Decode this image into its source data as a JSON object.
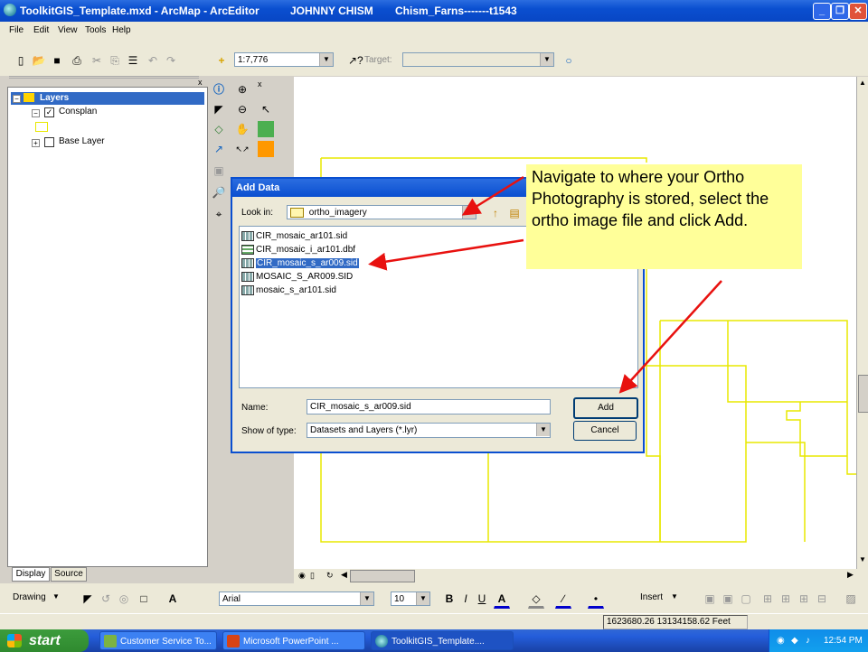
{
  "titlebar": {
    "doc": "ToolkitGIS_Template.mxd - ArcMap - ArcEditor",
    "user": "JOHNNY CHISM",
    "machine": "Chism_Farns-------t1543"
  },
  "menu": [
    "File",
    "Edit",
    "View",
    "Tools",
    "Help"
  ],
  "toolbar": {
    "scale": "1:7,776",
    "target_label": "Target:"
  },
  "toc": {
    "layers_label": "Layers",
    "consplan_label": "Consplan",
    "base_layer_label": "Base Layer",
    "tab_display": "Display",
    "tab_source": "Source"
  },
  "dialog": {
    "title": "Add Data",
    "look_in_label": "Look in:",
    "look_in_value": "ortho_imagery",
    "files": [
      {
        "name": "CIR_mosaic_ar101.sid",
        "type": "raster",
        "selected": false
      },
      {
        "name": "CIR_mosaic_i_ar101.dbf",
        "type": "table",
        "selected": false
      },
      {
        "name": "CIR_mosaic_s_ar009.sid",
        "type": "raster",
        "selected": true
      },
      {
        "name": "MOSAIC_S_AR009.SID",
        "type": "raster",
        "selected": false
      },
      {
        "name": "mosaic_s_ar101.sid",
        "type": "raster",
        "selected": false
      }
    ],
    "name_label": "Name:",
    "name_value": "CIR_mosaic_s_ar009.sid",
    "type_label": "Show of type:",
    "type_value": "Datasets and Layers (*.lyr)",
    "add_label": "Add",
    "cancel_label": "Cancel"
  },
  "callout": {
    "text": "Navigate to where your Ortho Photography is stored, select the ortho image file and click Add."
  },
  "drawing_toolbar": {
    "drawing_label": "Drawing",
    "font": "Arial",
    "size": "10",
    "insert_label": "Insert"
  },
  "status": {
    "coordinates": "1623680.26 13134158.62 Feet"
  },
  "taskbar": {
    "start": "start",
    "tasks": [
      "Customer Service To...",
      "Microsoft PowerPoint ...",
      "ToolkitGIS_Template...."
    ],
    "clock": "12:54 PM"
  },
  "colors": {
    "titlebar": "#0a4fd0",
    "callout_bg": "#ffff99",
    "arrow": "#e8110f",
    "parcel_lines": "#e8e800",
    "selection": "#316ac5"
  }
}
